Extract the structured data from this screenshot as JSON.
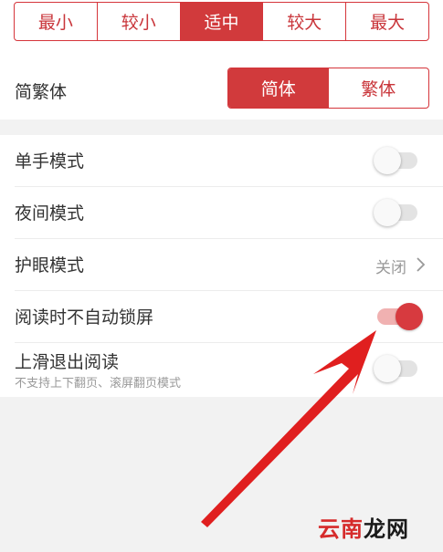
{
  "font_size": {
    "options": [
      "最小",
      "较小",
      "适中",
      "较大",
      "最大"
    ],
    "selected": "适中"
  },
  "script": {
    "label": "简繁体",
    "options": [
      "简体",
      "繁体"
    ],
    "selected": "简体"
  },
  "settings": {
    "one_hand": {
      "label": "单手模式",
      "enabled": false
    },
    "night": {
      "label": "夜间模式",
      "enabled": false
    },
    "eye_care": {
      "label": "护眼模式",
      "value": "关闭"
    },
    "no_autolock": {
      "label": "阅读时不自动锁屏",
      "enabled": true
    },
    "swipe_exit": {
      "label": "上滑退出阅读",
      "sublabel": "不支持上下翻页、滚屏翻页模式",
      "enabled": false
    }
  },
  "annotation": {
    "arrow_color": "#e01f1f",
    "points_to": "阅读时不自动锁屏 toggle"
  },
  "watermark": {
    "part1": "云南",
    "part2": "龙网"
  },
  "colors": {
    "accent": "#d13a3c",
    "background": "#f2f2f2"
  }
}
